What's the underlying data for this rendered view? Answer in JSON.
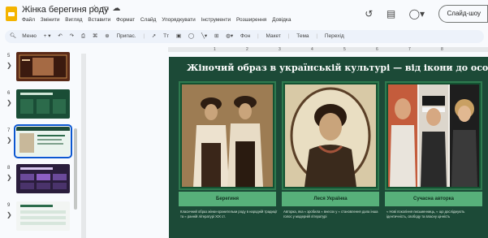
{
  "title_bar": {
    "doc_title": "Жінка берегиня роду",
    "slideshow_label": "Слайд-шоу"
  },
  "menu": [
    "Файл",
    "Змінити",
    "Вигляд",
    "Вставити",
    "Формат",
    "Слайд",
    "Упорядкувати",
    "Інструменти",
    "Розширення",
    "Довідка"
  ],
  "toolbar": {
    "menus_label": "Меню",
    "zoom_label": "Припас.",
    "background_label": "Фон",
    "layout_label": "Макет",
    "theme_label": "Тема",
    "transition_label": "Перехід"
  },
  "filmstrip": {
    "slides": [
      {
        "number": "5",
        "theme": "brown"
      },
      {
        "number": "6",
        "theme": "green"
      },
      {
        "number": "7",
        "theme": "green-portrait",
        "selected": true
      },
      {
        "number": "8",
        "theme": "purple"
      },
      {
        "number": "9",
        "theme": "list"
      }
    ]
  },
  "ruler": {
    "marks": [
      "1",
      "2",
      "3",
      "4",
      "5",
      "6",
      "7",
      "8"
    ]
  },
  "slide": {
    "title": "Жіночий образ в українській культурі — від ікони до особистості",
    "cards": [
      {
        "caption": "Берегиня",
        "description": "Класичний образ жінки-хранительки роду в народній традиції та ≈ ранній літературі XIX ст."
      },
      {
        "caption": "Леся Українка",
        "description": "Авторка, яка ≈ зробила ≈ внесок у ≈ становлення дала інша голос у модерній літературі"
      },
      {
        "caption": "Сучасна авторка",
        "description": "≈ Нові покоління письменниць, ≈ що досліджують ідентичність, свободу та власну цінність"
      }
    ]
  },
  "colors": {
    "slide_bg": "#1c4a37",
    "caption_bg": "#57b07a",
    "accent": "#0b57d0"
  }
}
